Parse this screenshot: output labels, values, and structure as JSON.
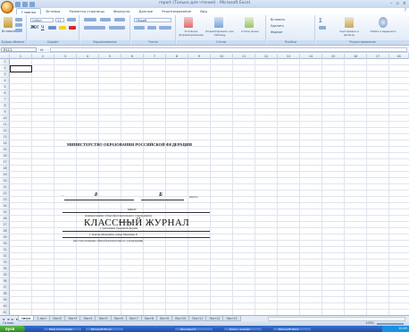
{
  "window": {
    "title": "report (Только для чтения) - Microsoft Excel",
    "controls": [
      "–",
      "▫",
      "×"
    ]
  },
  "ribbon": {
    "tabs": [
      "Главная",
      "Вставка",
      "Разметка страницы",
      "Формулы",
      "Данные",
      "Рецензирование",
      "Вид"
    ],
    "active_tab": "Главная",
    "groups": [
      "Буфер обмена",
      "Шрифт",
      "Выравнивание",
      "Число",
      "Стили",
      "Ячейки",
      "Редактирование"
    ],
    "paste_label": "Вставить",
    "font_name": "Calibri",
    "font_size": "11",
    "number_format": "Общий",
    "styles_buttons": [
      "Условное форматирование",
      "Форматировать как таблицу",
      "Стили ячеек"
    ],
    "cells_buttons": [
      "Вставить",
      "Удалить",
      "Формат"
    ],
    "edit_buttons": [
      "Сортировка и фильтр",
      "Найти и выделить"
    ]
  },
  "formula_bar": {
    "name_box": "R1C1",
    "fx": "fx",
    "value": ""
  },
  "grid": {
    "columns": [
      "1",
      "2",
      "3",
      "4",
      "5",
      "6",
      "7",
      "8",
      "9",
      "10",
      "11",
      "12",
      "13",
      "14",
      "15",
      "16",
      "17",
      "18"
    ],
    "rows": [
      "1",
      "2",
      "3",
      "4",
      "5",
      "6",
      "7",
      "8",
      "9",
      "10",
      "11",
      "12",
      "13",
      "14",
      "15",
      "16",
      "17",
      "18",
      "19",
      "20",
      "21",
      "22",
      "23",
      "24",
      "25",
      "26",
      "27",
      "28",
      "29",
      "30",
      "31",
      "32",
      "33",
      "34",
      "35",
      "36",
      "37",
      "38",
      "39",
      "40",
      "41"
    ]
  },
  "sheet_content": {
    "ministry": "МИНИСТЕРСТВО ОБРАЗОВАНИЯ РОССИЙСКОЙ ФЕДЕРАЦИИ",
    "journal_title": "КЛАССНЫЙ ЖУРНАЛ",
    "grade_number": "8",
    "grade_letter": "Б",
    "class_word": "класса",
    "school_short": "МБОУ",
    "school_caption": "(наименование общеобразовательного учреждения)",
    "line3": "Гимназия № 1",
    "line4": "с указанием правовой формы",
    "line5": "г. Ханты-Мансийск улица Мисника 8",
    "location_caption": "(местоположение общеобразовательного учреждения)"
  },
  "sheets": {
    "nav": "◄ ◄ ► ►",
    "tabs": [
      "титул",
      "1 лист",
      "Лист2",
      "Лист3",
      "Лист4",
      "Лист5",
      "Лист6",
      "Лист7",
      "Лист8",
      "Лист9",
      "Лист10",
      "Лист11",
      "Лист12",
      "Лист13"
    ],
    "active": "титул"
  },
  "status": {
    "ready": "Готово",
    "zoom": "100%"
  },
  "taskbar": {
    "start": "пуск",
    "buttons": [
      "Total Commander",
      "Microsoft Excel",
      "Документ1",
      "Класс. журнал",
      "Microsoft Word"
    ],
    "clock": "10:45"
  }
}
